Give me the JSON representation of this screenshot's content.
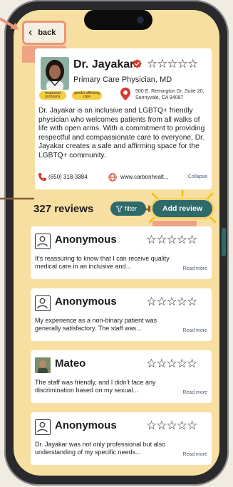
{
  "nav": {
    "back_label": "back",
    "back_tap_hint": "(tap)"
  },
  "doctor": {
    "name": "Dr. Jayakar",
    "rating_stars": "☆☆☆☆☆",
    "specialty": "Primary Care Physician, MD",
    "tags": [
      "respected pronouns",
      "gender affirming care"
    ],
    "address": "500 E. Remington Dr, Suite 20, Sunnyvale, CA 94087",
    "bio": "Dr. Jayakar is an inclusive and LGBTQ+ friendly physician who welcomes patients from all walks of life with open arms. With a commitment to providing respectful and compassionate care to everyone, Dr. Jayakar creates a safe and affirming space for the LGBTQ+ community.",
    "phone": "(650) 318-3384",
    "website": "www.carbonhealt...",
    "collapse_label": "Collapse"
  },
  "reviews_header": {
    "count_label": "327 reviews",
    "filter_label": "filter",
    "add_review_label": "Add review",
    "add_review_tap_hint": "(tap)"
  },
  "reviews": [
    {
      "author": "Anonymous",
      "stars": "☆☆☆☆☆",
      "text": "It's reassuring to know that I can receive quality medical care in an inclusive and...",
      "read_more": "Read more",
      "avatar": "user-outline-icon"
    },
    {
      "author": "Anonymous",
      "stars": "☆☆☆☆☆",
      "text": "My experience as a non-binary patient was generally satisfactory. The staff was...",
      "read_more": "Read more",
      "avatar": "user-outline-icon"
    },
    {
      "author": "Mateo",
      "stars": "☆☆☆☆☆",
      "text": "The staff was friendly, and I didn't face any discrimination based on my sexual...",
      "read_more": "Read more",
      "avatar": "photo"
    },
    {
      "author": "Anonymous",
      "stars": "☆☆☆☆☆",
      "text": "Dr. Jayakar was not only professional but also understanding of my specific needs...",
      "read_more": "Read more",
      "avatar": "user-outline-icon"
    }
  ],
  "colors": {
    "screen_bg": "#f7dfa2",
    "accent_teal": "#2f6a6b",
    "annotation_salmon": "#f0a284",
    "tag_yellow": "#f4cc3c",
    "pin_red": "#d63a2a"
  }
}
